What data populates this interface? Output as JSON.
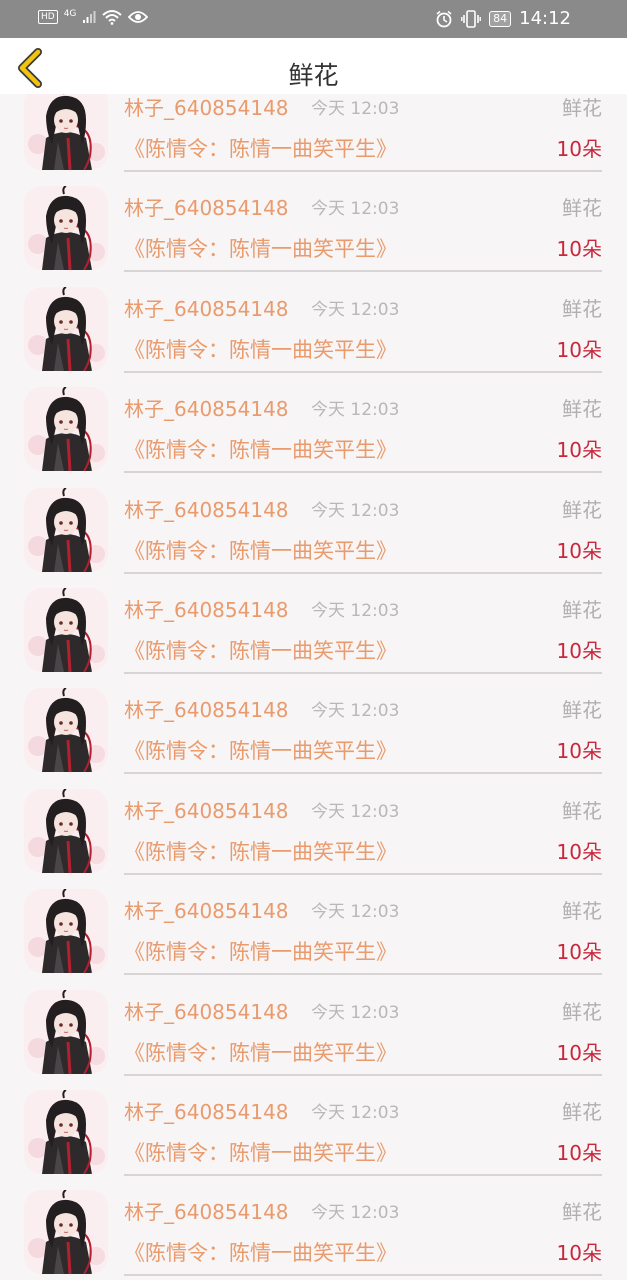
{
  "status_bar": {
    "hd": "HD",
    "network": "4G",
    "battery": "84",
    "time": "14:12",
    "icons": [
      "signal-icon",
      "wifi-icon",
      "eye-icon",
      "alarm-icon",
      "vibrate-icon"
    ]
  },
  "header": {
    "title": "鲜花",
    "back_icon": "chevron-left-icon",
    "accent_color": "#f2c40f"
  },
  "colors": {
    "name": "#e99b6d",
    "amount": "#c8283c",
    "muted": "#b0b0b0"
  },
  "records": [
    {
      "user": "林子_640854148",
      "time": "今天 12:03",
      "type": "鲜花",
      "book": "《陈情令：陈情一曲笑平生》",
      "amount": "10朵"
    },
    {
      "user": "林子_640854148",
      "time": "今天 12:03",
      "type": "鲜花",
      "book": "《陈情令：陈情一曲笑平生》",
      "amount": "10朵"
    },
    {
      "user": "林子_640854148",
      "time": "今天 12:03",
      "type": "鲜花",
      "book": "《陈情令：陈情一曲笑平生》",
      "amount": "10朵"
    },
    {
      "user": "林子_640854148",
      "time": "今天 12:03",
      "type": "鲜花",
      "book": "《陈情令：陈情一曲笑平生》",
      "amount": "10朵"
    },
    {
      "user": "林子_640854148",
      "time": "今天 12:03",
      "type": "鲜花",
      "book": "《陈情令：陈情一曲笑平生》",
      "amount": "10朵"
    },
    {
      "user": "林子_640854148",
      "time": "今天 12:03",
      "type": "鲜花",
      "book": "《陈情令：陈情一曲笑平生》",
      "amount": "10朵"
    },
    {
      "user": "林子_640854148",
      "time": "今天 12:03",
      "type": "鲜花",
      "book": "《陈情令：陈情一曲笑平生》",
      "amount": "10朵"
    },
    {
      "user": "林子_640854148",
      "time": "今天 12:03",
      "type": "鲜花",
      "book": "《陈情令：陈情一曲笑平生》",
      "amount": "10朵"
    },
    {
      "user": "林子_640854148",
      "time": "今天 12:03",
      "type": "鲜花",
      "book": "《陈情令：陈情一曲笑平生》",
      "amount": "10朵"
    },
    {
      "user": "林子_640854148",
      "time": "今天 12:03",
      "type": "鲜花",
      "book": "《陈情令：陈情一曲笑平生》",
      "amount": "10朵"
    },
    {
      "user": "林子_640854148",
      "time": "今天 12:03",
      "type": "鲜花",
      "book": "《陈情令：陈情一曲笑平生》",
      "amount": "10朵"
    },
    {
      "user": "林子_640854148",
      "time": "今天 12:03",
      "type": "鲜花",
      "book": "《陈情令：陈情一曲笑平生》",
      "amount": "10朵"
    }
  ]
}
